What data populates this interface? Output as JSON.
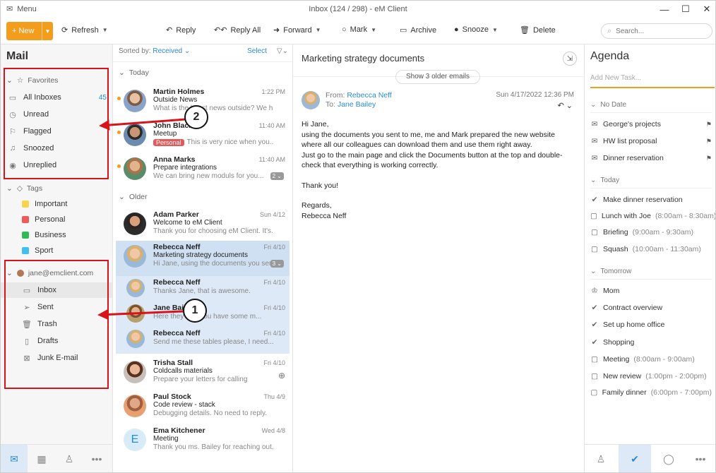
{
  "window": {
    "menu_label": "Menu",
    "title": "Inbox (124 / 298) - eM Client"
  },
  "toolbar": {
    "new_label": "New",
    "refresh_label": "Refresh",
    "reply_label": "Reply",
    "reply_all_label": "Reply All",
    "forward_label": "Forward",
    "mark_label": "Mark",
    "archive_label": "Archive",
    "snooze_label": "Snooze",
    "delete_label": "Delete",
    "search_placeholder": "Search..."
  },
  "sidebar": {
    "title": "Mail",
    "favorites_label": "Favorites",
    "favorites": [
      {
        "label": "All Inboxes",
        "count": "45",
        "icon": "inbox-icon"
      },
      {
        "label": "Unread",
        "count": "",
        "icon": "clock-icon"
      },
      {
        "label": "Flagged",
        "count": "",
        "icon": "flag-icon"
      },
      {
        "label": "Snoozed",
        "count": "",
        "icon": "bell-icon"
      },
      {
        "label": "Unreplied",
        "count": "",
        "icon": "eye-icon"
      }
    ],
    "tags_label": "Tags",
    "tags": [
      {
        "label": "Important",
        "color": "#f7d44c"
      },
      {
        "label": "Personal",
        "color": "#ee5a5a"
      },
      {
        "label": "Business",
        "color": "#2fba5a"
      },
      {
        "label": "Sport",
        "color": "#3fc0f0"
      }
    ],
    "account_label": "jane@emclient.com",
    "folders": [
      {
        "label": "Inbox",
        "icon": "inbox-icon"
      },
      {
        "label": "Sent",
        "icon": "send-icon"
      },
      {
        "label": "Trash",
        "icon": "trash-icon"
      },
      {
        "label": "Drafts",
        "icon": "draft-icon"
      },
      {
        "label": "Junk E-mail",
        "icon": "junk-icon"
      }
    ]
  },
  "list": {
    "sorted_by_label": "Sorted by:",
    "sorted_by_value": "Received",
    "select_label": "Select",
    "group_today": "Today",
    "group_older": "Older",
    "messages": [
      {
        "from": "Martin Holmes",
        "date": "1:22 PM",
        "subject": "Outside News",
        "preview": "What is the latest news outside? We have be...",
        "unread": true
      },
      {
        "from": "John Black",
        "date": "11:40 AM",
        "subject": "Meetup",
        "preview": "This is very nice when you...",
        "tag": "Personal",
        "unread": true
      },
      {
        "from": "Anna Marks",
        "date": "11:40 AM",
        "subject": "Prepare integrations",
        "preview": "We can bring new moduls for you...",
        "badge": "2",
        "unread": true
      },
      {
        "from": "Adam Parker",
        "date": "Sun 4/12",
        "subject": "Welcome to eM Client",
        "preview": "Thank you for choosing eM Client. It's..."
      },
      {
        "from": "Rebecca Neff",
        "date": "Fri 4/10",
        "subject": "Marketing strategy documents",
        "preview": "Hi Jane, using the documents you sent...",
        "badge": "3"
      },
      {
        "from": "Rebecca Neff",
        "date": "Fri 4/10",
        "subject": "",
        "preview": "Thanks Jane, that is awesome."
      },
      {
        "from": "Jane Bailey",
        "date": "Fri 4/10",
        "subject": "",
        "preview": "Here they are, you have some m..."
      },
      {
        "from": "Rebecca Neff",
        "date": "Fri 4/10",
        "subject": "",
        "preview": "Send me these tables please, I need..."
      },
      {
        "from": "Trisha Stall",
        "date": "Fri 4/10",
        "subject": "Coldcalls materials",
        "preview": "Prepare your letters for calling"
      },
      {
        "from": "Paul Stock",
        "date": "Thu 4/9",
        "subject": "Code review - stack",
        "preview": "Debugging details. No need to reply."
      },
      {
        "from": "Ema Kitchener",
        "date": "Wed 4/8",
        "subject": "Meeting",
        "preview": "Thank you ms. Bailey for reaching out...",
        "initial": "E"
      }
    ]
  },
  "reader": {
    "subject": "Marketing strategy documents",
    "older_emails_label": "Show 3 older emails",
    "from_label": "From:",
    "from_name": "Rebecca Neff",
    "to_label": "To:",
    "to_name": "Jane Bailey",
    "date": "Sun 4/17/2022 12:36 PM",
    "greeting": "Hi Jane,",
    "para1": "using the documents you sent to me, me and Mark prepared the new website where all our colleagues can download them and use them right away.",
    "para2": "Just go to the main page and click the Documents button at the top and double-check that everything is working correctly.",
    "thanks": "Thank you!",
    "regards": "Regards,",
    "signature": "Rebecca Neff"
  },
  "agenda": {
    "title": "Agenda",
    "add_task_placeholder": "Add New Task...",
    "no_date_label": "No Date",
    "no_date": [
      {
        "label": "George's projects",
        "icon": "email-icon"
      },
      {
        "label": "HW list proposal",
        "icon": "email-icon"
      },
      {
        "label": "Dinner reservation",
        "icon": "email-icon"
      }
    ],
    "today_label": "Today",
    "today": [
      {
        "label": "Make dinner reservation",
        "time": "",
        "icon": "check-icon"
      },
      {
        "label": "Lunch with Joe",
        "time": "(8:00am - 8:30am)",
        "icon": "calendar-icon"
      },
      {
        "label": "Briefing",
        "time": "(9:00am - 9:30am)",
        "icon": "calendar-icon"
      },
      {
        "label": "Squash",
        "time": "(10:00am - 11:30am)",
        "icon": "calendar-icon"
      }
    ],
    "tomorrow_label": "Tomorrow",
    "tomorrow": [
      {
        "label": "Mom",
        "time": "",
        "icon": "birthday-icon"
      },
      {
        "label": "Contract overview",
        "time": "",
        "icon": "check-icon"
      },
      {
        "label": "Set up home office",
        "time": "",
        "icon": "check-icon"
      },
      {
        "label": "Shopping",
        "time": "",
        "icon": "check-icon"
      },
      {
        "label": "Meeting",
        "time": "(8:00am - 9:00am)",
        "icon": "calendar-icon"
      },
      {
        "label": "New review",
        "time": "(1:00pm - 2:00pm)",
        "icon": "calendar-icon"
      },
      {
        "label": "Family dinner",
        "time": "(6:00pm - 7:00pm)",
        "icon": "calendar-icon"
      }
    ]
  },
  "callouts": {
    "one": "1",
    "two": "2"
  },
  "colors": {
    "accent": "#f49c1c",
    "link": "#2a8ad4",
    "annotation": "#d9131a"
  }
}
